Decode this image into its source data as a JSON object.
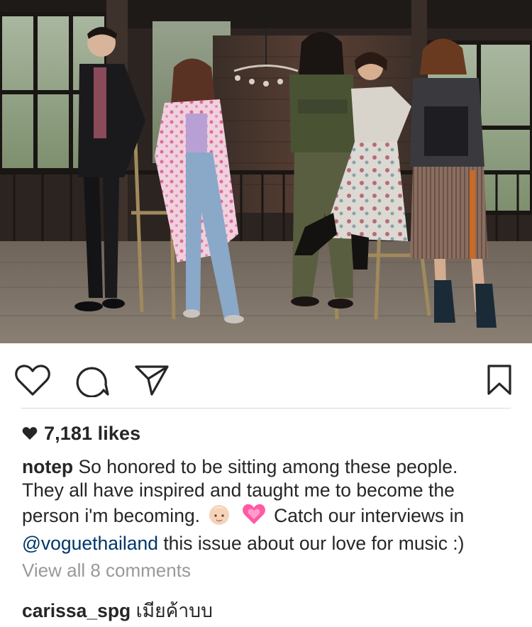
{
  "post": {
    "image_alt": "Five people posing with wooden chairs in a loft",
    "likes": "7,181 likes",
    "caption": {
      "username": "notep",
      "line1_text": "So honored to be sitting among these people.",
      "line2": "They all have inspired and taught me to become the",
      "line3_before": "person i'm becoming.",
      "line3_after": "Catch our interviews in",
      "mention": "@voguethailand",
      "line4_after": "this issue about our love for music :)"
    },
    "view_all_comments": "View all 8 comments",
    "comments": [
      {
        "username": "carissa_spg",
        "text": "เมียค้าบบ"
      }
    ]
  },
  "icons": {
    "like": "heart-outline-icon",
    "comment": "speech-bubble-icon",
    "share": "paper-plane-icon",
    "save": "bookmark-icon",
    "likes_heart": "heart-filled-icon",
    "emoji_1": "baby-emoji-icon",
    "emoji_2": "sparkling-heart-emoji-icon"
  },
  "colors": {
    "text": "#262626",
    "muted": "#999999",
    "mention": "#003569",
    "divider": "#dbdbdb",
    "emoji_heart": "#ff5aa5"
  }
}
